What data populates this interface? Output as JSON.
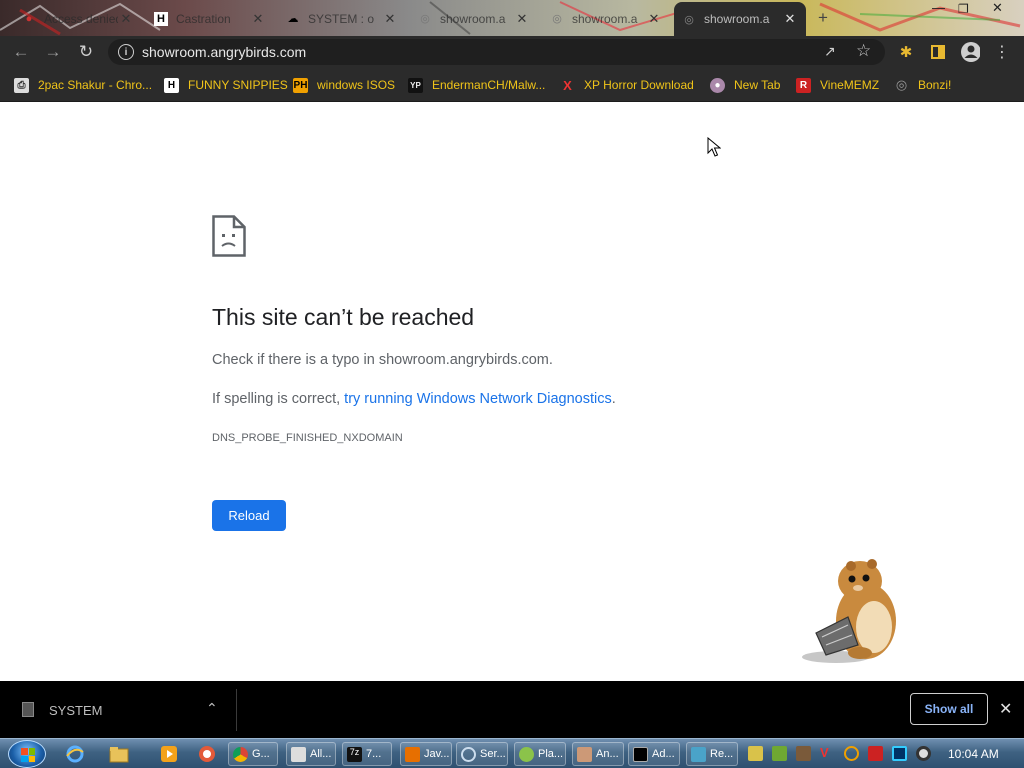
{
  "browser": {
    "tabs": [
      {
        "title": "Access denied",
        "icon": "angry-bird-icon"
      },
      {
        "title": "Castration",
        "icon": "h-logo-icon"
      },
      {
        "title": "SYSTEM : o",
        "icon": "cloud-icon"
      },
      {
        "title": "showroom.a",
        "icon": "globe-icon"
      },
      {
        "title": "showroom.a",
        "icon": "globe-icon"
      },
      {
        "title": "showroom.a",
        "icon": "globe-icon",
        "active": true
      }
    ],
    "new_tab": "+",
    "url": "showroom.angrybirds.com",
    "bookmarks": [
      {
        "label": "2pac Shakur - Chro...",
        "icon": "printer-icon"
      },
      {
        "label": "FUNNY SNIPPIES",
        "icon": "h-logo-icon"
      },
      {
        "label": "windows ISOS",
        "icon": "ph-logo-icon",
        "badge": "PH"
      },
      {
        "label": "EndermanCH/Malw...",
        "icon": "yp-logo-icon",
        "badge": "YP"
      },
      {
        "label": "XP Horror Download",
        "icon": "x-logo-icon",
        "badge": "X"
      },
      {
        "label": "New Tab",
        "icon": "globe-icon"
      },
      {
        "label": "VineMEMZ",
        "icon": "r-logo-icon",
        "badge": "R"
      },
      {
        "label": "Bonzi!",
        "icon": "globe-icon"
      }
    ]
  },
  "error_page": {
    "title": "This site can’t be reached",
    "line1": "Check if there is a typo in showroom.angrybirds.com.",
    "line2_prefix": "If spelling is correct, ",
    "line2_link": "try running Windows Network Diagnostics",
    "line2_suffix": ".",
    "code": "DNS_PROBE_FINISHED_NXDOMAIN",
    "reload_label": "Reload"
  },
  "download_bar": {
    "file_name": "SYSTEM",
    "show_all_label": "Show all"
  },
  "taskbar": {
    "items": [
      {
        "label": "G...",
        "icon": "chrome-icon"
      },
      {
        "label": "All...",
        "icon": "window-icon"
      },
      {
        "label": "7...",
        "icon": "7zip-icon"
      },
      {
        "label": "Jav...",
        "icon": "java-icon"
      },
      {
        "label": "Ser...",
        "icon": "search-icon"
      },
      {
        "label": "Pla...",
        "icon": "plants-icon"
      },
      {
        "label": "An...",
        "icon": "character-icon"
      },
      {
        "label": "Ad...",
        "icon": "cmd-icon"
      },
      {
        "label": "Re...",
        "icon": "registry-icon"
      }
    ],
    "clock": "10:04 AM"
  },
  "colors": {
    "accent": "#1a73e8",
    "bookmark_text": "#f0c419",
    "toolbar_bg": "#2b2b2b"
  }
}
